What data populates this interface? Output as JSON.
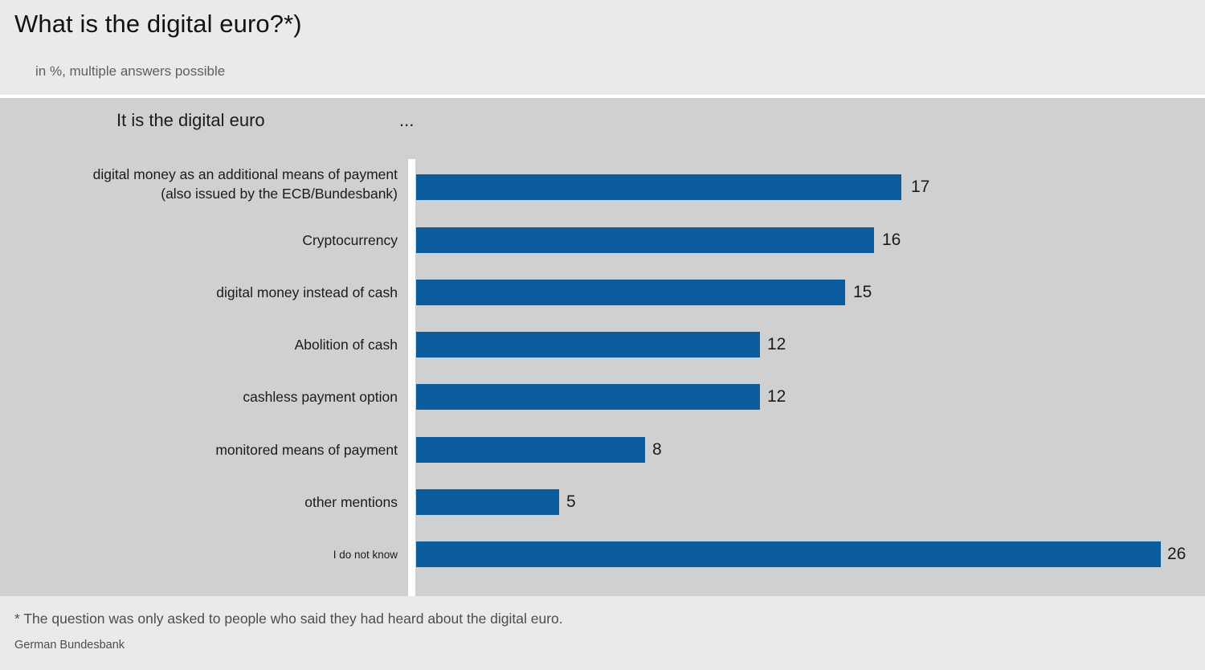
{
  "header": {
    "title": "What is the digital euro?*)",
    "subtitle": "in %, multiple answers possible"
  },
  "panel": {
    "heading": "It is the digital euro",
    "heading_ellipsis": "..."
  },
  "footer": {
    "footnote": "* The question was only asked to people who said they had heard about the digital euro.",
    "source": "German Bundesbank"
  },
  "colors": {
    "bar": "#0a5c9e",
    "panel_background": "#d0d0d0",
    "band_background": "#eaeaea",
    "axis": "#ffffff",
    "text": "#1b1b1b"
  },
  "chart_data": {
    "type": "bar",
    "orientation": "horizontal",
    "title": "What is the digital euro?*)",
    "subtitle": "in %, multiple answers possible",
    "xlabel": "",
    "ylabel": "It is the digital euro ...",
    "unit": "%",
    "grid": false,
    "legend": "none",
    "xlim": [
      0,
      26
    ],
    "categories": [
      "digital money as an additional means of payment\n(also issued by the ECB/Bundesbank)",
      "Cryptocurrency",
      "digital money instead of cash",
      "Abolition of cash",
      "cashless payment option",
      "monitored means of payment",
      "other mentions",
      "I do not know"
    ],
    "values": [
      17,
      16,
      15,
      12,
      12,
      8,
      5,
      26
    ],
    "value_labels": [
      "17",
      "16",
      "15",
      "12",
      "12",
      "8",
      "5",
      "26"
    ]
  }
}
